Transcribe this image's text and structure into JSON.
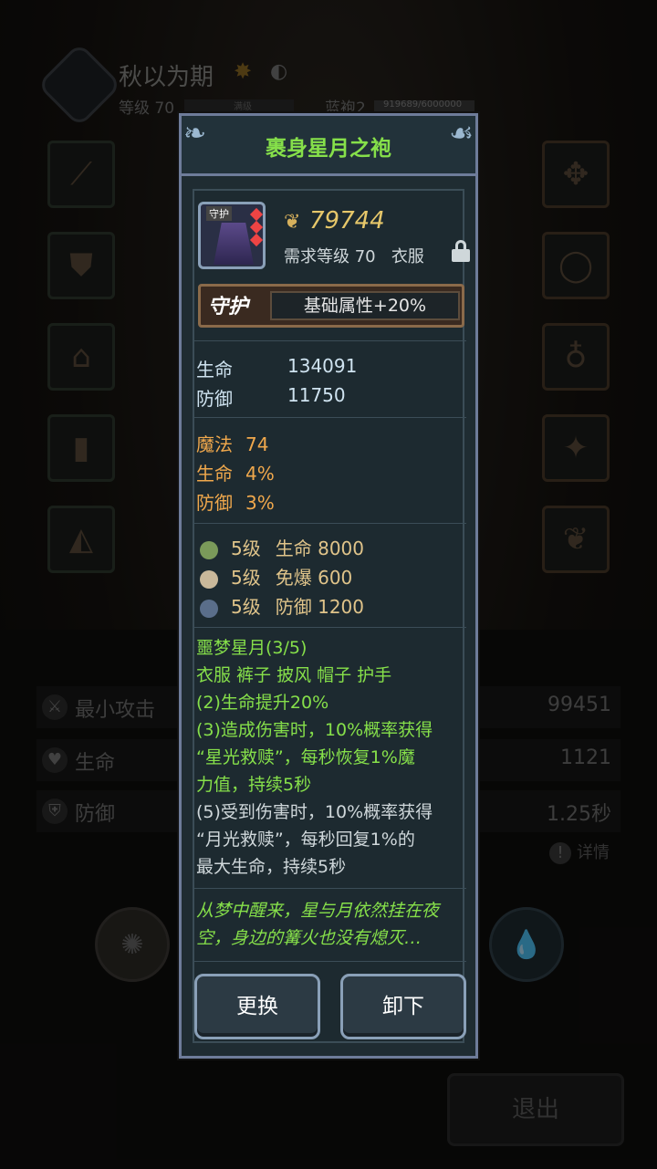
{
  "background": {
    "player_name": "秋以为期",
    "level_text": "等级 70",
    "exp_label": "满级",
    "second_title": "蓝袍2",
    "second_bar_text": "919689/6000000",
    "stats": [
      {
        "label": "最小攻击",
        "value": "99451",
        "icon": "attack-icon"
      },
      {
        "label": "生命",
        "value": "1121",
        "icon": "heart-icon"
      },
      {
        "label": "防御",
        "value": "1.25秒",
        "icon": "shield-icon"
      }
    ],
    "detail_label": "详情",
    "exit_label": "退出"
  },
  "item": {
    "name": "裹身星月之袍",
    "icon_tag": "守护",
    "price": "79744",
    "requirement": "需求等级 70",
    "slot_type": "衣服",
    "guard_label": "守护",
    "guard_value": "基础属性+20%",
    "base_stats": [
      {
        "label": "生命",
        "value": "134091"
      },
      {
        "label": "防御",
        "value": "11750"
      }
    ],
    "extra_stats": [
      {
        "label": "魔法",
        "value": "74"
      },
      {
        "label": "生命",
        "value": "4%"
      },
      {
        "label": "防御",
        "value": "3%"
      }
    ],
    "gems": [
      {
        "level": "5级",
        "stat": "生命 8000",
        "color": "#7a9a5a"
      },
      {
        "level": "5级",
        "stat": "免爆 600",
        "color": "#c9b89a"
      },
      {
        "level": "5级",
        "stat": "防御 1200",
        "color": "#5a6e8a"
      }
    ],
    "set": {
      "title": "噩梦星月(3/5)",
      "pieces": "衣服 裤子 披风 帽子 护手",
      "effects": [
        "(2)生命提升20%",
        "(3)造成伤害时，10%概率获得",
        "“星光救赎”，每秒恢复1%魔",
        "力值，持续5秒"
      ],
      "inactive_effects": [
        "(5)受到伤害时，10%概率获得",
        "“月光救赎”，每秒回复1%的",
        "最大生命，持续5秒"
      ]
    },
    "flavor_lines": [
      "从梦中醒来，星与月依然挂在夜",
      "空，身边的篝火也没有熄灭…"
    ]
  },
  "buttons": {
    "replace": "更换",
    "unequip": "卸下"
  },
  "colors": {
    "title_green": "#86e04a",
    "price_gold": "#e6c76a",
    "extra_orange": "#f0a84c",
    "modal_border": "#6e7c9a"
  }
}
